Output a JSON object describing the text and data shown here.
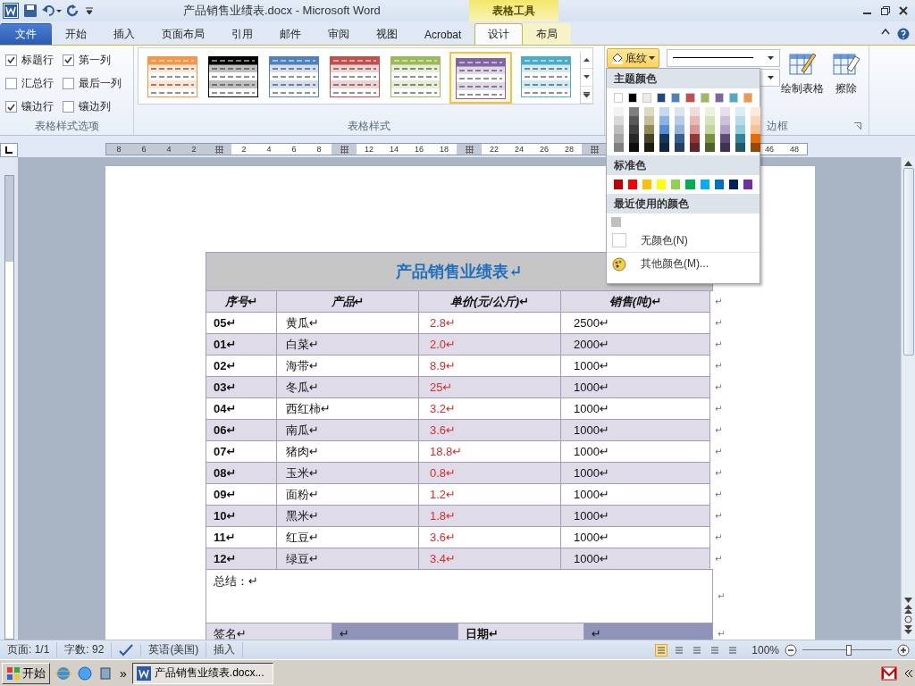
{
  "title_bar": {
    "title": "产品销售业绩表.docx  -  Microsoft Word",
    "context_group": "表格工具"
  },
  "tabs": [
    {
      "label": "文件",
      "kind": "file",
      "selected": false
    },
    {
      "label": "开始",
      "kind": "normal",
      "selected": false
    },
    {
      "label": "插入",
      "kind": "normal",
      "selected": false
    },
    {
      "label": "页面布局",
      "kind": "normal",
      "selected": false
    },
    {
      "label": "引用",
      "kind": "normal",
      "selected": false
    },
    {
      "label": "邮件",
      "kind": "normal",
      "selected": false
    },
    {
      "label": "审阅",
      "kind": "normal",
      "selected": false
    },
    {
      "label": "视图",
      "kind": "normal",
      "selected": false
    },
    {
      "label": "Acrobat",
      "kind": "normal",
      "selected": false
    },
    {
      "label": "设计",
      "kind": "context",
      "selected": true
    },
    {
      "label": "布局",
      "kind": "context",
      "selected": false
    }
  ],
  "ribbon": {
    "style_options": {
      "label": "表格样式选项",
      "checkboxes": [
        {
          "label": "标题行",
          "checked": true
        },
        {
          "label": "第一列",
          "checked": true
        },
        {
          "label": "汇总行",
          "checked": false
        },
        {
          "label": "最后一列",
          "checked": false
        },
        {
          "label": "镶边行",
          "checked": true
        },
        {
          "label": "镶边列",
          "checked": false
        }
      ]
    },
    "table_styles": {
      "label": "表格样式",
      "items": [
        {
          "color": "#f79646",
          "selected": false
        },
        {
          "color": "#000000",
          "selected": false
        },
        {
          "color": "#4f81bd",
          "selected": false
        },
        {
          "color": "#c0504d",
          "selected": false
        },
        {
          "color": "#9bbb59",
          "selected": false
        },
        {
          "color": "#8064a2",
          "selected": true
        },
        {
          "color": "#4bacc6",
          "selected": false
        }
      ]
    },
    "shading_button": {
      "label": "底纹"
    },
    "borders": {
      "label": "边框",
      "buttons": [
        {
          "label": "绘制表格",
          "kind": "draw"
        },
        {
          "label": "擦除",
          "kind": "erase"
        }
      ]
    }
  },
  "ruler": [
    {
      "kind": "num",
      "text": "8"
    },
    {
      "kind": "num",
      "text": "6"
    },
    {
      "kind": "num",
      "text": "4"
    },
    {
      "kind": "num",
      "text": "2"
    },
    {
      "kind": "marker"
    },
    {
      "kind": "num",
      "text": "2"
    },
    {
      "kind": "num",
      "text": "4"
    },
    {
      "kind": "num",
      "text": "6"
    },
    {
      "kind": "num",
      "text": "8"
    },
    {
      "kind": "marker"
    },
    {
      "kind": "num",
      "text": "12"
    },
    {
      "kind": "num",
      "text": "14"
    },
    {
      "kind": "num",
      "text": "16"
    },
    {
      "kind": "num",
      "text": "18"
    },
    {
      "kind": "marker"
    },
    {
      "kind": "num",
      "text": "22"
    },
    {
      "kind": "num",
      "text": "24"
    },
    {
      "kind": "num",
      "text": "26"
    },
    {
      "kind": "num",
      "text": "28"
    },
    {
      "kind": "marker"
    },
    {
      "kind": "blank"
    },
    {
      "kind": "blank"
    },
    {
      "kind": "blank"
    },
    {
      "kind": "blank"
    },
    {
      "kind": "blank"
    },
    {
      "kind": "blank"
    },
    {
      "kind": "num",
      "text": "46"
    },
    {
      "kind": "num",
      "text": "48"
    }
  ],
  "table": {
    "title": "产品销售业绩表↵",
    "columns": [
      "序号↵",
      "产品↵",
      "单价(元/公斤)↵",
      "销售(吨)↵"
    ],
    "header_end": "↵",
    "rows": [
      {
        "cells": [
          "05↵",
          "黄瓜↵",
          "2.8↵",
          "2500↵"
        ],
        "end": "↵"
      },
      {
        "cells": [
          "01↵",
          "白菜↵",
          "2.0↵",
          "2000↵"
        ],
        "end": "↵"
      },
      {
        "cells": [
          "02↵",
          "海带↵",
          "8.9↵",
          "1000↵"
        ],
        "end": "↵"
      },
      {
        "cells": [
          "03↵",
          "冬瓜↵",
          "25↵",
          "1000↵"
        ],
        "end": "↵"
      },
      {
        "cells": [
          "04↵",
          "西红柿↵",
          "3.2↵",
          "1000↵"
        ],
        "end": "↵"
      },
      {
        "cells": [
          "06↵",
          "南瓜↵",
          "3.6↵",
          "1000↵"
        ],
        "end": "↵"
      },
      {
        "cells": [
          "07↵",
          "猪肉↵",
          "18.8↵",
          "1000↵"
        ],
        "end": "↵"
      },
      {
        "cells": [
          "08↵",
          "玉米↵",
          "0.8↵",
          "1000↵"
        ],
        "end": "↵"
      },
      {
        "cells": [
          "09↵",
          "面粉↵",
          "1.2↵",
          "1000↵"
        ],
        "end": "↵"
      },
      {
        "cells": [
          "10↵",
          "黑米↵",
          "1.8↵",
          "1000↵"
        ],
        "end": "↵"
      },
      {
        "cells": [
          "11↵",
          "红豆↵",
          "3.6↵",
          "1000↵"
        ],
        "end": "↵"
      },
      {
        "cells": [
          "12↵",
          "绿豆↵",
          "3.4↵",
          "1000↵"
        ],
        "end": "↵"
      }
    ],
    "summary": "总结：↵",
    "summary_end": "↵",
    "signature": [
      "签名↵",
      "↵",
      "日期↵",
      "↵"
    ],
    "signature_end": "↵"
  },
  "shading_menu": {
    "theme_label": "主题颜色",
    "theme_colors": [
      {
        "color": "#ffffff",
        "shades": [
          {
            "color": "#f2f2f2"
          },
          {
            "color": "#d9d9d9"
          },
          {
            "color": "#bfbfbf"
          },
          {
            "color": "#a6a6a6"
          },
          {
            "color": "#808080"
          }
        ]
      },
      {
        "color": "#000000",
        "shades": [
          {
            "color": "#7f7f7f"
          },
          {
            "color": "#595959"
          },
          {
            "color": "#404040"
          },
          {
            "color": "#262626"
          },
          {
            "color": "#0d0d0d"
          }
        ]
      },
      {
        "color": "#eeece1",
        "shades": [
          {
            "color": "#ddd9c3"
          },
          {
            "color": "#c4bd97"
          },
          {
            "color": "#938953"
          },
          {
            "color": "#494429"
          },
          {
            "color": "#1d1b10"
          }
        ]
      },
      {
        "color": "#1f497d",
        "shades": [
          {
            "color": "#c6d9f0"
          },
          {
            "color": "#8db3e2"
          },
          {
            "color": "#548dd4"
          },
          {
            "color": "#17365d"
          },
          {
            "color": "#0f243e"
          }
        ]
      },
      {
        "color": "#4f81bd",
        "shades": [
          {
            "color": "#dbe5f1"
          },
          {
            "color": "#b8cce4"
          },
          {
            "color": "#95b3d7"
          },
          {
            "color": "#366092"
          },
          {
            "color": "#244061"
          }
        ]
      },
      {
        "color": "#c0504d",
        "shades": [
          {
            "color": "#f2dcdb"
          },
          {
            "color": "#e5b9b7"
          },
          {
            "color": "#d99694"
          },
          {
            "color": "#953734"
          },
          {
            "color": "#632423"
          }
        ]
      },
      {
        "color": "#9bbb59",
        "shades": [
          {
            "color": "#ebf1dd"
          },
          {
            "color": "#d7e3bc"
          },
          {
            "color": "#c3d69b"
          },
          {
            "color": "#76923c"
          },
          {
            "color": "#4f6128"
          }
        ]
      },
      {
        "color": "#8064a2",
        "shades": [
          {
            "color": "#e5e0ec"
          },
          {
            "color": "#ccc1d9"
          },
          {
            "color": "#b2a2c7"
          },
          {
            "color": "#5f497a"
          },
          {
            "color": "#3f3151"
          }
        ]
      },
      {
        "color": "#4bacc6",
        "shades": [
          {
            "color": "#dbeef3"
          },
          {
            "color": "#b7dde8"
          },
          {
            "color": "#92cddc"
          },
          {
            "color": "#31859b"
          },
          {
            "color": "#205867"
          }
        ]
      },
      {
        "color": "#f79646",
        "shades": [
          {
            "color": "#fdeada"
          },
          {
            "color": "#fbd5b5"
          },
          {
            "color": "#fac08f"
          },
          {
            "color": "#e36c09"
          },
          {
            "color": "#974806"
          }
        ]
      }
    ],
    "standard_label": "标准色",
    "standard_colors": [
      {
        "color": "#c00000"
      },
      {
        "color": "#ff0000"
      },
      {
        "color": "#ffc000"
      },
      {
        "color": "#ffff00"
      },
      {
        "color": "#92d050"
      },
      {
        "color": "#00b050"
      },
      {
        "color": "#00b0f0"
      },
      {
        "color": "#0070c0"
      },
      {
        "color": "#002060"
      },
      {
        "color": "#7030a0"
      }
    ],
    "recent_label": "最近使用的颜色",
    "recent_colors": [
      {
        "color": "#c0c0c0"
      }
    ],
    "no_color": "无颜色(N)",
    "more_colors": "其他颜色(M)..."
  },
  "status_bar": {
    "page": "页面: 1/1",
    "words": "字数: 92",
    "language": "英语(美国)",
    "mode": "插入",
    "zoom": "100%",
    "zoom_slider": {
      "level": 0.52
    }
  },
  "taskbar": {
    "start": "开始",
    "chevron": "»",
    "window": "产品销售业绩表.docx..."
  }
}
